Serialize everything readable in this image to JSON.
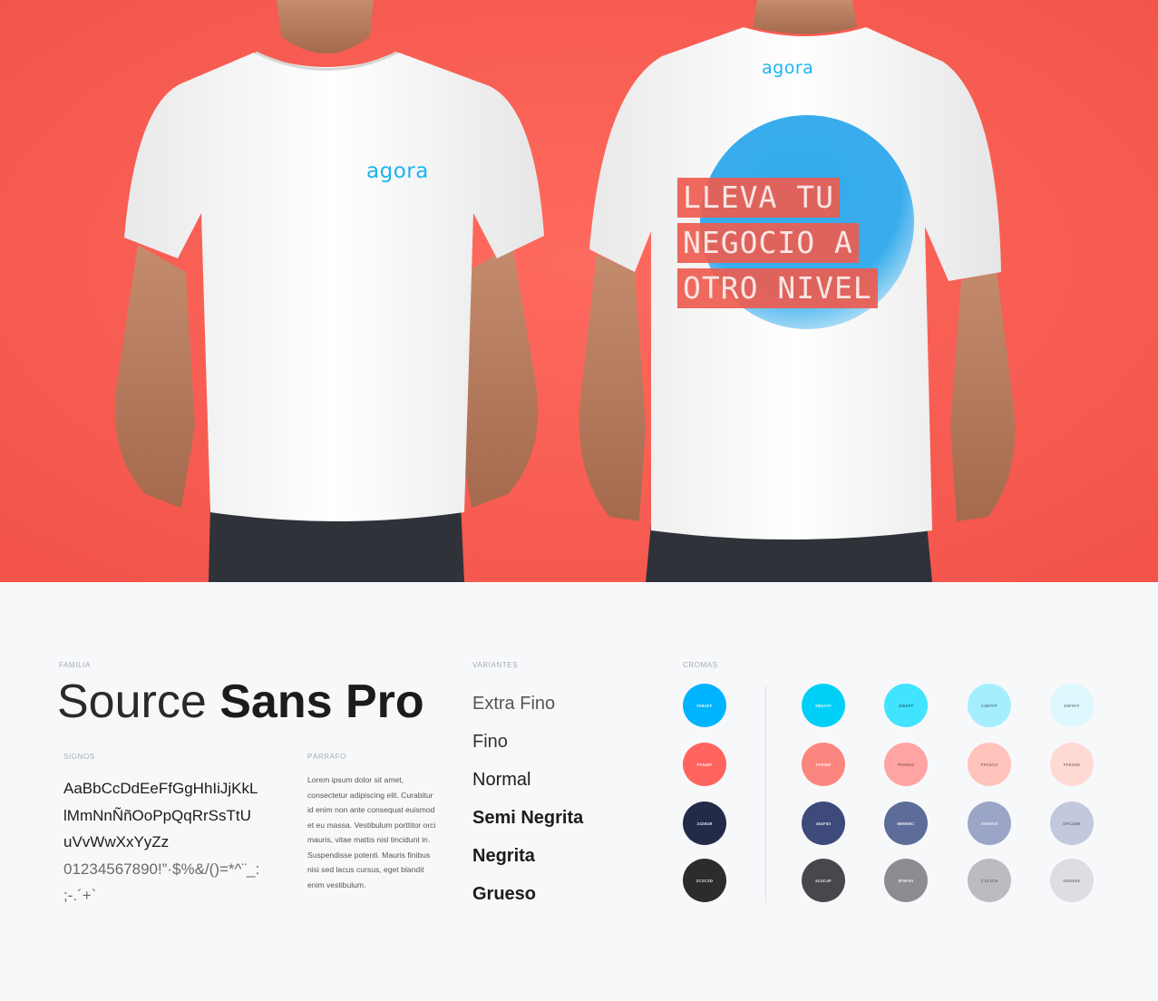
{
  "mockup": {
    "front_logo": "agora",
    "back_logo": "agora",
    "slogan_lines": [
      "LLEVA TU",
      "NEGOCIO A",
      "OTRO NIVEL"
    ]
  },
  "typography": {
    "family_label": "FAMILIA",
    "family_name_light": "Source",
    "family_name_bold": "Sans Pro",
    "signs_label": "SIGNOS",
    "glyph_lines": [
      "AaBbCcDdEeFfGgHhIiJjKkL",
      "lMmNnÑñOoPpQqRrSsTtU",
      "uVvWwXxYyZz"
    ],
    "symbol_lines": [
      "01234567890!”·$%&/()=*^¨_:",
      ";-.´+`"
    ],
    "paragraph_label": "PÁRRAFO",
    "paragraph_text": "Lorem ipsum dolor sit amet, consectetur adipiscing elit. Curabitur id enim non ante consequat euismod et eu massa. Vestibulum porttitor orci mauris, vitae mattis nisl tincidunt in. Suspendisse potenti. Mauris finibus nisi sed lacus cursus, eget blandit enim vestibulum.",
    "variants_label": "VARIANTES",
    "variants": [
      "Extra Fino",
      "Fino",
      "Normal",
      "Semi Negrita",
      "Negrita",
      "Grueso"
    ]
  },
  "colors": {
    "label": "CROMAS",
    "primary": [
      {
        "hex": "#00B4FF",
        "text": "00B4FF"
      },
      {
        "hex": "#FF645F",
        "text": "FF645F"
      },
      {
        "hex": "#242B49",
        "text": "242B49"
      },
      {
        "hex": "#2C2C2D",
        "text": "2C2C2D"
      }
    ],
    "tints": [
      [
        {
          "hex": "#00D0F7",
          "text": "38DAFF"
        },
        {
          "hex": "#40E4FF",
          "text": "38E8FF"
        },
        {
          "hex": "#A5EEFF",
          "text": "C5EFFF"
        },
        {
          "hex": "#DDF8FF",
          "text": "E8F8FF"
        }
      ],
      [
        {
          "hex": "#FB867F",
          "text": "FF8380"
        },
        {
          "hex": "#FFA3A3",
          "text": "FFA5A4"
        },
        {
          "hex": "#FFC3BC",
          "text": "FFC6C0"
        },
        {
          "hex": "#FFDAD4",
          "text": "FFE3DE"
        }
      ],
      [
        {
          "hex": "#3D4A7A",
          "text": "454F83"
        },
        {
          "hex": "#5E6C9A",
          "text": "6B6BBC"
        },
        {
          "hex": "#9BA5C6",
          "text": "A5A5C6"
        },
        {
          "hex": "#C2C8DD",
          "text": "DFC2DB"
        }
      ],
      [
        {
          "hex": "#47484B",
          "text": "4C4C4F"
        },
        {
          "hex": "#8B8D91",
          "text": "8F8F93"
        },
        {
          "hex": "#BBBCC0",
          "text": "C1C1C5"
        },
        {
          "hex": "#DCDEE3",
          "text": "DEDEE0"
        }
      ]
    ]
  }
}
